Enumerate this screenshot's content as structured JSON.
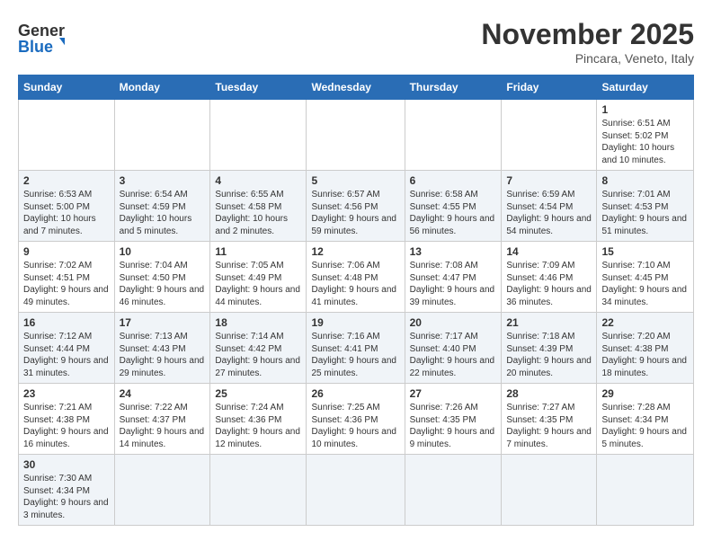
{
  "header": {
    "logo_general": "General",
    "logo_blue": "Blue",
    "title": "November 2025",
    "location": "Pincara, Veneto, Italy"
  },
  "days_of_week": [
    "Sunday",
    "Monday",
    "Tuesday",
    "Wednesday",
    "Thursday",
    "Friday",
    "Saturday"
  ],
  "weeks": [
    {
      "days": [
        {
          "num": "",
          "info": ""
        },
        {
          "num": "",
          "info": ""
        },
        {
          "num": "",
          "info": ""
        },
        {
          "num": "",
          "info": ""
        },
        {
          "num": "",
          "info": ""
        },
        {
          "num": "",
          "info": ""
        },
        {
          "num": "1",
          "info": "Sunrise: 6:51 AM\nSunset: 5:02 PM\nDaylight: 10 hours and 10 minutes."
        }
      ]
    },
    {
      "days": [
        {
          "num": "2",
          "info": "Sunrise: 6:53 AM\nSunset: 5:00 PM\nDaylight: 10 hours and 7 minutes."
        },
        {
          "num": "3",
          "info": "Sunrise: 6:54 AM\nSunset: 4:59 PM\nDaylight: 10 hours and 5 minutes."
        },
        {
          "num": "4",
          "info": "Sunrise: 6:55 AM\nSunset: 4:58 PM\nDaylight: 10 hours and 2 minutes."
        },
        {
          "num": "5",
          "info": "Sunrise: 6:57 AM\nSunset: 4:56 PM\nDaylight: 9 hours and 59 minutes."
        },
        {
          "num": "6",
          "info": "Sunrise: 6:58 AM\nSunset: 4:55 PM\nDaylight: 9 hours and 56 minutes."
        },
        {
          "num": "7",
          "info": "Sunrise: 6:59 AM\nSunset: 4:54 PM\nDaylight: 9 hours and 54 minutes."
        },
        {
          "num": "8",
          "info": "Sunrise: 7:01 AM\nSunset: 4:53 PM\nDaylight: 9 hours and 51 minutes."
        }
      ]
    },
    {
      "days": [
        {
          "num": "9",
          "info": "Sunrise: 7:02 AM\nSunset: 4:51 PM\nDaylight: 9 hours and 49 minutes."
        },
        {
          "num": "10",
          "info": "Sunrise: 7:04 AM\nSunset: 4:50 PM\nDaylight: 9 hours and 46 minutes."
        },
        {
          "num": "11",
          "info": "Sunrise: 7:05 AM\nSunset: 4:49 PM\nDaylight: 9 hours and 44 minutes."
        },
        {
          "num": "12",
          "info": "Sunrise: 7:06 AM\nSunset: 4:48 PM\nDaylight: 9 hours and 41 minutes."
        },
        {
          "num": "13",
          "info": "Sunrise: 7:08 AM\nSunset: 4:47 PM\nDaylight: 9 hours and 39 minutes."
        },
        {
          "num": "14",
          "info": "Sunrise: 7:09 AM\nSunset: 4:46 PM\nDaylight: 9 hours and 36 minutes."
        },
        {
          "num": "15",
          "info": "Sunrise: 7:10 AM\nSunset: 4:45 PM\nDaylight: 9 hours and 34 minutes."
        }
      ]
    },
    {
      "days": [
        {
          "num": "16",
          "info": "Sunrise: 7:12 AM\nSunset: 4:44 PM\nDaylight: 9 hours and 31 minutes."
        },
        {
          "num": "17",
          "info": "Sunrise: 7:13 AM\nSunset: 4:43 PM\nDaylight: 9 hours and 29 minutes."
        },
        {
          "num": "18",
          "info": "Sunrise: 7:14 AM\nSunset: 4:42 PM\nDaylight: 9 hours and 27 minutes."
        },
        {
          "num": "19",
          "info": "Sunrise: 7:16 AM\nSunset: 4:41 PM\nDaylight: 9 hours and 25 minutes."
        },
        {
          "num": "20",
          "info": "Sunrise: 7:17 AM\nSunset: 4:40 PM\nDaylight: 9 hours and 22 minutes."
        },
        {
          "num": "21",
          "info": "Sunrise: 7:18 AM\nSunset: 4:39 PM\nDaylight: 9 hours and 20 minutes."
        },
        {
          "num": "22",
          "info": "Sunrise: 7:20 AM\nSunset: 4:38 PM\nDaylight: 9 hours and 18 minutes."
        }
      ]
    },
    {
      "days": [
        {
          "num": "23",
          "info": "Sunrise: 7:21 AM\nSunset: 4:38 PM\nDaylight: 9 hours and 16 minutes."
        },
        {
          "num": "24",
          "info": "Sunrise: 7:22 AM\nSunset: 4:37 PM\nDaylight: 9 hours and 14 minutes."
        },
        {
          "num": "25",
          "info": "Sunrise: 7:24 AM\nSunset: 4:36 PM\nDaylight: 9 hours and 12 minutes."
        },
        {
          "num": "26",
          "info": "Sunrise: 7:25 AM\nSunset: 4:36 PM\nDaylight: 9 hours and 10 minutes."
        },
        {
          "num": "27",
          "info": "Sunrise: 7:26 AM\nSunset: 4:35 PM\nDaylight: 9 hours and 9 minutes."
        },
        {
          "num": "28",
          "info": "Sunrise: 7:27 AM\nSunset: 4:35 PM\nDaylight: 9 hours and 7 minutes."
        },
        {
          "num": "29",
          "info": "Sunrise: 7:28 AM\nSunset: 4:34 PM\nDaylight: 9 hours and 5 minutes."
        }
      ]
    },
    {
      "days": [
        {
          "num": "30",
          "info": "Sunrise: 7:30 AM\nSunset: 4:34 PM\nDaylight: 9 hours and 3 minutes."
        },
        {
          "num": "",
          "info": ""
        },
        {
          "num": "",
          "info": ""
        },
        {
          "num": "",
          "info": ""
        },
        {
          "num": "",
          "info": ""
        },
        {
          "num": "",
          "info": ""
        },
        {
          "num": "",
          "info": ""
        }
      ]
    }
  ]
}
